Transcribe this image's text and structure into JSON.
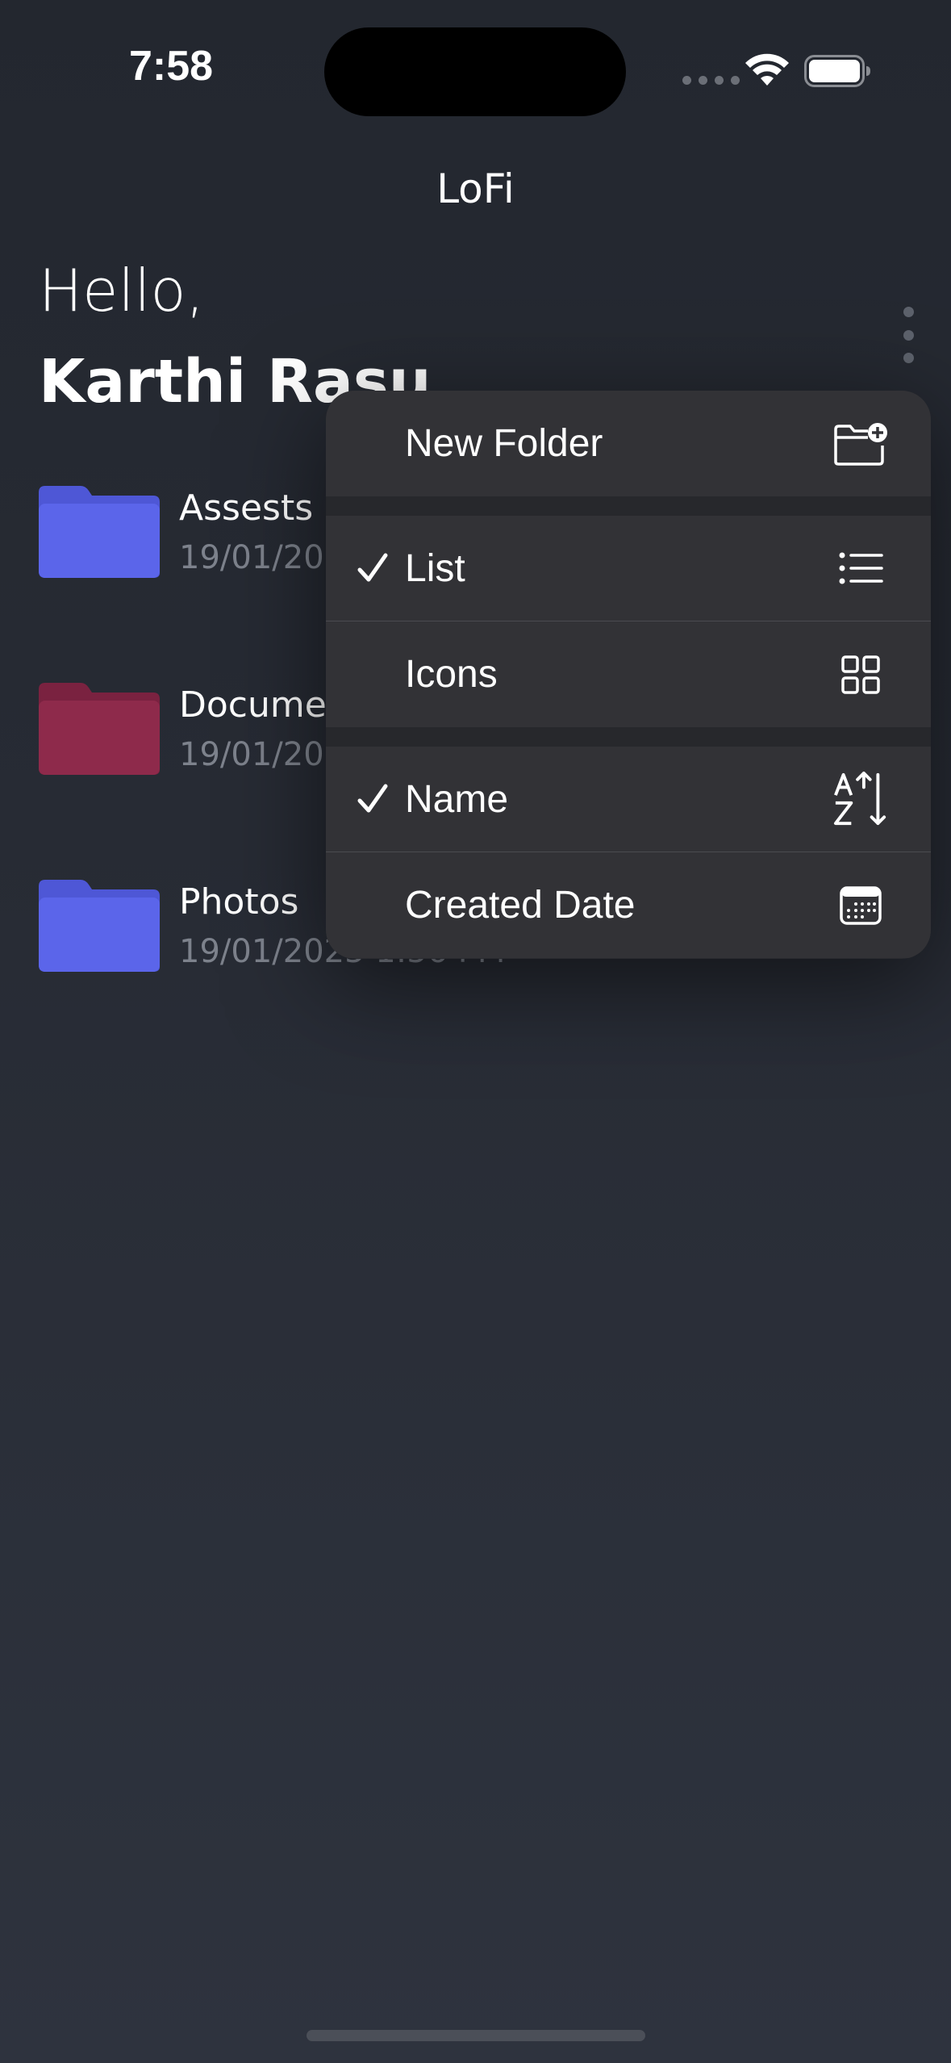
{
  "status_bar": {
    "time": "7:58"
  },
  "header": {
    "title": "LoFi"
  },
  "greeting": {
    "hello": "Hello,",
    "name": "Karthi Rasu"
  },
  "folders": [
    {
      "name": "Assests",
      "date": "19/01/2025 1:56 PM",
      "color": "#5b65ea"
    },
    {
      "name": "Documents",
      "date": "19/01/2025 1:56 PM",
      "color": "#8e2a4b"
    },
    {
      "name": "Photos",
      "date": "19/01/2025 1:56 PM",
      "color": "#5b65ea"
    }
  ],
  "menu": {
    "new_folder": {
      "label": "New Folder",
      "icon": "folder-plus-icon"
    },
    "view_options": [
      {
        "label": "List",
        "checked": true,
        "icon": "list-icon"
      },
      {
        "label": "Icons",
        "checked": false,
        "icon": "grid-icon"
      }
    ],
    "sort_options": [
      {
        "label": "Name",
        "checked": true,
        "icon": "sort-az-icon"
      },
      {
        "label": "Created Date",
        "checked": false,
        "icon": "calendar-icon"
      }
    ]
  },
  "colors": {
    "background": "#272b34",
    "menu_background": "#323236",
    "folder_blue": "#5b65ea",
    "folder_red": "#8e2a4b",
    "secondary_text": "#7d828c"
  }
}
